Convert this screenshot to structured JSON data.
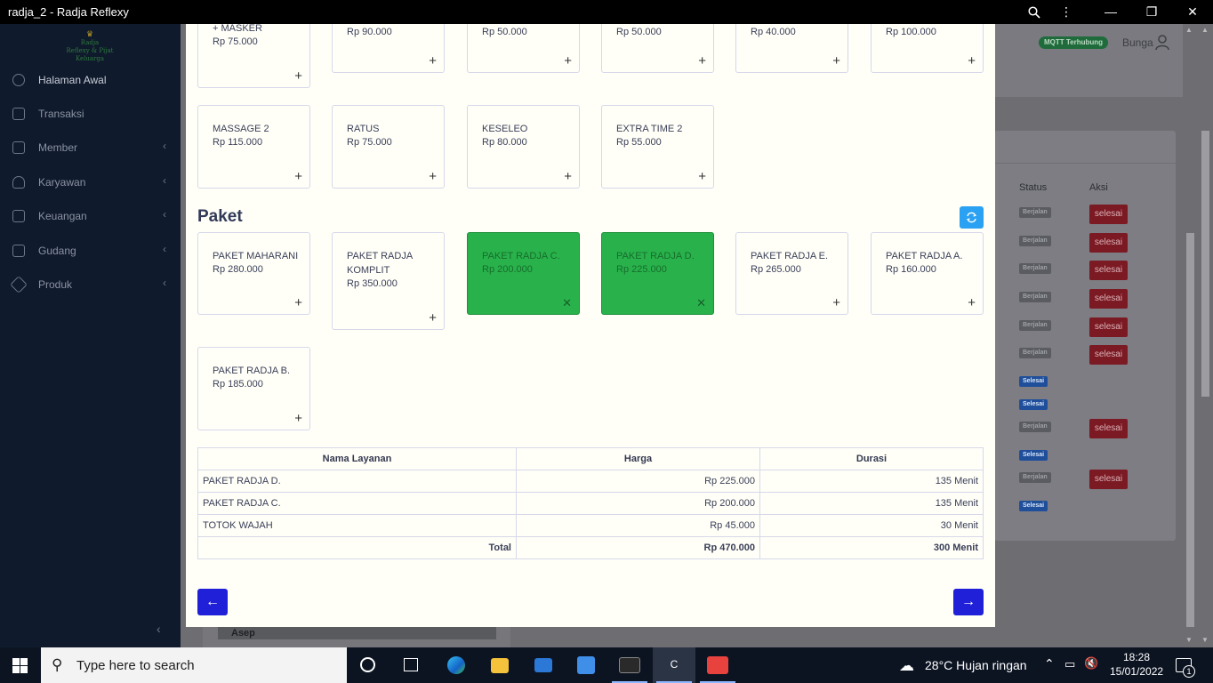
{
  "window": {
    "title": "radja_2 - Radja Reflexy"
  },
  "brand": {
    "name": "Radja",
    "tagline": "Reflexy & Pijat Keluarga"
  },
  "sidebar": {
    "items": [
      {
        "label": "Halaman Awal",
        "icon": "dashboard-icon"
      },
      {
        "label": "Transaksi",
        "icon": "transaction-icon"
      },
      {
        "label": "Member",
        "icon": "member-icon"
      },
      {
        "label": "Karyawan",
        "icon": "employee-icon"
      },
      {
        "label": "Keuangan",
        "icon": "finance-icon"
      },
      {
        "label": "Gudang",
        "icon": "warehouse-icon"
      },
      {
        "label": "Produk",
        "icon": "product-icon"
      }
    ]
  },
  "header": {
    "mqtt_status": "MQTT Terhubung",
    "user": "Bunga"
  },
  "background_table": {
    "col_status": "Status",
    "col_action": "Aksi",
    "running": "Berjalan",
    "done": "Selesai",
    "finish_button": "selesai"
  },
  "background_footer": {
    "name": "Asep"
  },
  "services_top": [
    {
      "name": "+ MASKER",
      "price": "Rp 75.000"
    },
    {
      "name": "",
      "price": "Rp 90.000"
    },
    {
      "name": "",
      "price": "Rp 50.000"
    },
    {
      "name": "",
      "price": "Rp 50.000"
    },
    {
      "name": "",
      "price": "Rp 40.000"
    },
    {
      "name": "",
      "price": "Rp 100.000"
    }
  ],
  "services_row2": [
    {
      "name": "MASSAGE 2",
      "price": "Rp 115.000"
    },
    {
      "name": "RATUS",
      "price": "Rp 75.000"
    },
    {
      "name": "KESELEO",
      "price": "Rp 80.000"
    },
    {
      "name": "EXTRA TIME 2",
      "price": "Rp 55.000"
    }
  ],
  "paket": {
    "title": "Paket",
    "items": [
      {
        "name": "PAKET MAHARANI",
        "price": "Rp 280.000",
        "selected": false
      },
      {
        "name": "PAKET RADJA KOMPLIT",
        "price": "Rp 350.000",
        "selected": false
      },
      {
        "name": "PAKET RADJA C.",
        "price": "Rp 200.000",
        "selected": true
      },
      {
        "name": "PAKET RADJA D.",
        "price": "Rp 225.000",
        "selected": true
      },
      {
        "name": "PAKET RADJA E.",
        "price": "Rp 265.000",
        "selected": false
      },
      {
        "name": "PAKET RADJA A.",
        "price": "Rp 160.000",
        "selected": false
      },
      {
        "name": "PAKET RADJA B.",
        "price": "Rp 185.000",
        "selected": false
      }
    ]
  },
  "summary": {
    "headers": [
      "Nama Layanan",
      "Harga",
      "Durasi"
    ],
    "rows": [
      [
        "PAKET RADJA D.",
        "Rp 225.000",
        "135 Menit"
      ],
      [
        "PAKET RADJA C.",
        "Rp 200.000",
        "135 Menit"
      ],
      [
        "TOTOK WAJAH",
        "Rp 45.000",
        "30 Menit"
      ]
    ],
    "total_label": "Total",
    "total_price": "Rp 470.000",
    "total_duration": "300 Menit"
  },
  "nav": {
    "prev": "←",
    "next": "→"
  },
  "taskbar": {
    "search_placeholder": "Type here to search",
    "weather": "28°C  Hujan ringan",
    "time": "18:28",
    "date": "15/01/2022",
    "notifications": "1",
    "active_app_label": "C"
  },
  "colors": {
    "accent_green": "#29b24b",
    "accent_blue": "#2020d8",
    "refresh_blue": "#2aa1f2"
  }
}
